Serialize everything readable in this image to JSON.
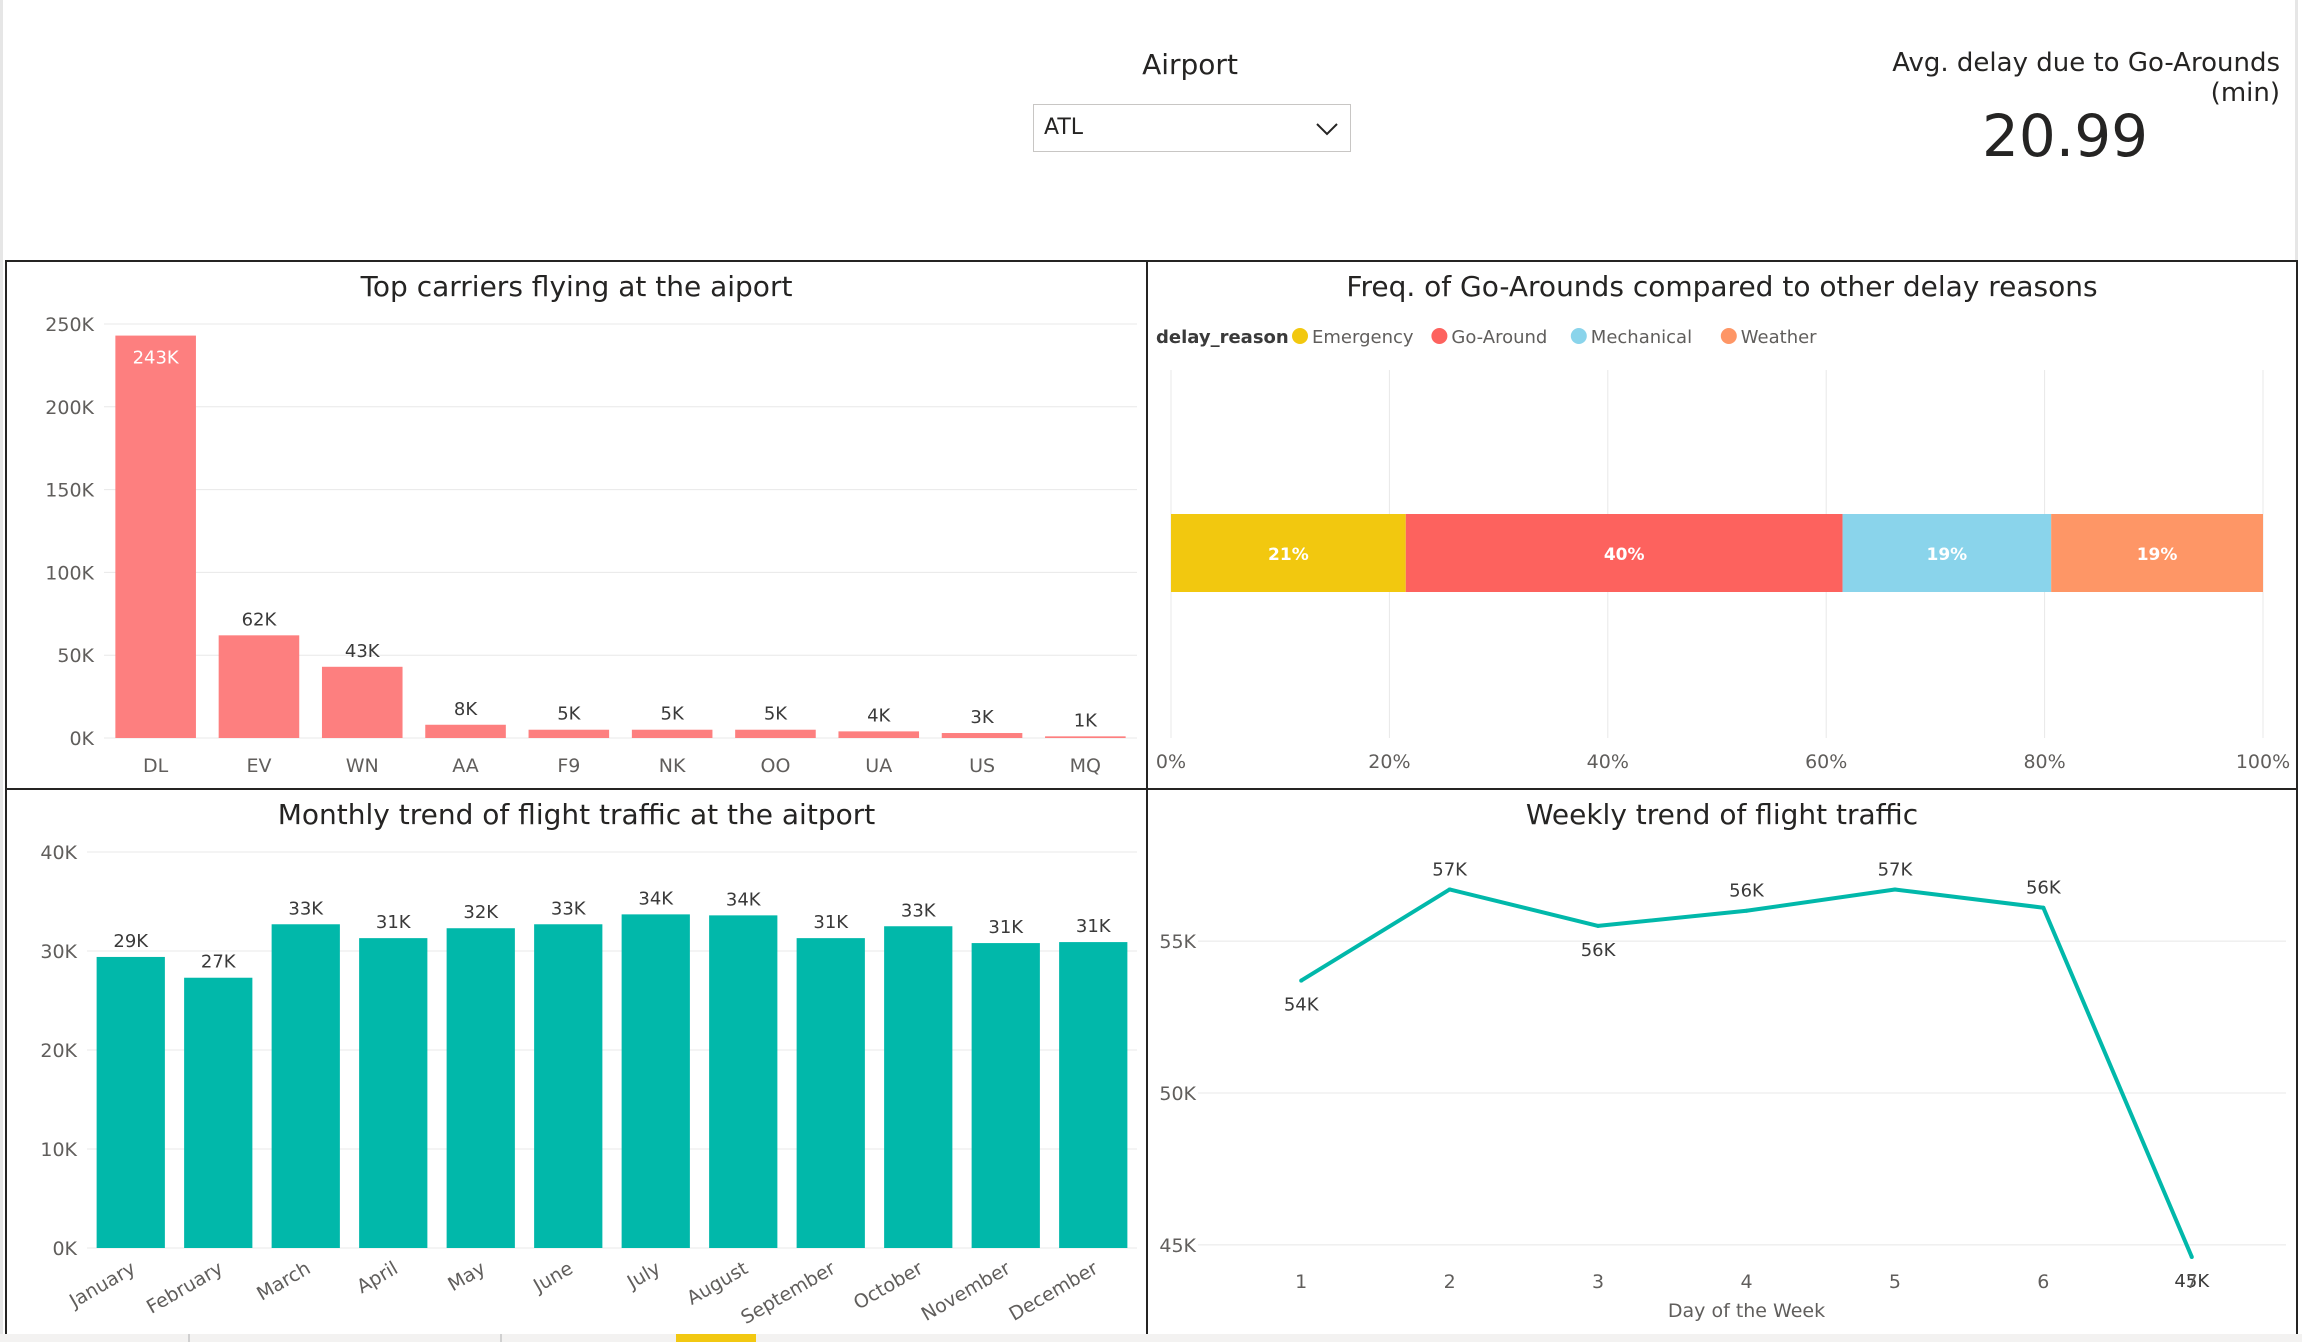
{
  "slicer": {
    "title": "Airport",
    "selected": "ATL",
    "icon": "chevron-down-icon"
  },
  "kpi": {
    "title": "Avg. delay due to Go-Arounds (min)",
    "value": "20.99"
  },
  "panels": {
    "carriers": {
      "title": "Top carriers flying at the aiport"
    },
    "delay": {
      "title": "Freq. of Go-Arounds compared to other delay reasons"
    },
    "monthly": {
      "title": "Monthly trend of flight traffic at the aitport"
    },
    "weekly": {
      "title": "Weekly trend of flight traffic"
    }
  },
  "colors": {
    "carrier_bar": "#fd7f7f",
    "month_bar": "#01b8aa",
    "week_line": "#01b8aa",
    "emergency": "#f2c80f",
    "go_around": "#fd625e",
    "mechanical": "#8ad4eb",
    "weather": "#fe9666",
    "gridline": "#e8e8e8",
    "axis_text": "#605e5c"
  },
  "chart_data": [
    {
      "id": "carriers",
      "type": "bar",
      "title": "Top carriers flying at the aiport",
      "categories": [
        "DL",
        "EV",
        "WN",
        "AA",
        "F9",
        "NK",
        "OO",
        "UA",
        "US",
        "MQ"
      ],
      "values": [
        243000,
        62000,
        43000,
        8000,
        5000,
        5000,
        5000,
        4000,
        3000,
        1000
      ],
      "data_labels": [
        "243K",
        "62K",
        "43K",
        "8K",
        "5K",
        "5K",
        "5K",
        "4K",
        "3K",
        "1K"
      ],
      "ylim": [
        0,
        250000
      ],
      "yticks": [
        0,
        50000,
        100000,
        150000,
        200000,
        250000
      ],
      "ytick_labels": [
        "0K",
        "50K",
        "100K",
        "150K",
        "200K",
        "250K"
      ],
      "grid": true
    },
    {
      "id": "delay",
      "type": "bar",
      "orientation": "horizontal-stacked-100",
      "title": "Freq. of Go-Arounds compared to other delay reasons",
      "legend_title": "delay_reason",
      "legend_position": "top-left",
      "series": [
        {
          "name": "Emergency",
          "value": 21.5,
          "label": "21%"
        },
        {
          "name": "Go-Around",
          "value": 40.0,
          "label": "40%"
        },
        {
          "name": "Mechanical",
          "value": 19.1,
          "label": "19%"
        },
        {
          "name": "Weather",
          "value": 19.4,
          "label": "19%"
        }
      ],
      "xlim": [
        0,
        100
      ],
      "xticks": [
        0,
        20,
        40,
        60,
        80,
        100
      ],
      "xtick_labels": [
        "0%",
        "20%",
        "40%",
        "60%",
        "80%",
        "100%"
      ],
      "grid": true
    },
    {
      "id": "monthly",
      "type": "bar",
      "title": "Monthly trend of flight traffic at the aitport",
      "categories": [
        "January",
        "February",
        "March",
        "April",
        "May",
        "June",
        "July",
        "August",
        "September",
        "October",
        "November",
        "December"
      ],
      "values": [
        29400,
        27300,
        32700,
        31300,
        32300,
        32700,
        33700,
        33600,
        31300,
        32500,
        30800,
        30900
      ],
      "data_labels": [
        "29K",
        "27K",
        "33K",
        "31K",
        "32K",
        "33K",
        "34K",
        "34K",
        "31K",
        "33K",
        "31K",
        "31K"
      ],
      "ylim": [
        0,
        40000
      ],
      "yticks": [
        0,
        10000,
        20000,
        30000,
        40000
      ],
      "ytick_labels": [
        "0K",
        "10K",
        "20K",
        "30K",
        "40K"
      ],
      "grid": true
    },
    {
      "id": "weekly",
      "type": "line",
      "title": "Weekly trend of flight traffic",
      "xlabel": "Day of the Week",
      "x": [
        1,
        2,
        3,
        4,
        5,
        6,
        7
      ],
      "xtick_labels": [
        "1",
        "2",
        "3",
        "4",
        "5",
        "6",
        "7"
      ],
      "values": [
        53700,
        56700,
        55500,
        56000,
        56700,
        56100,
        44600
      ],
      "data_labels": [
        "54K",
        "57K",
        "56K",
        "56K",
        "57K",
        "56K",
        "45K"
      ],
      "ylim": [
        44500,
        58000
      ],
      "yticks": [
        45000,
        50000,
        55000
      ],
      "ytick_labels": [
        "45K",
        "50K",
        "55K"
      ],
      "grid": true
    }
  ]
}
